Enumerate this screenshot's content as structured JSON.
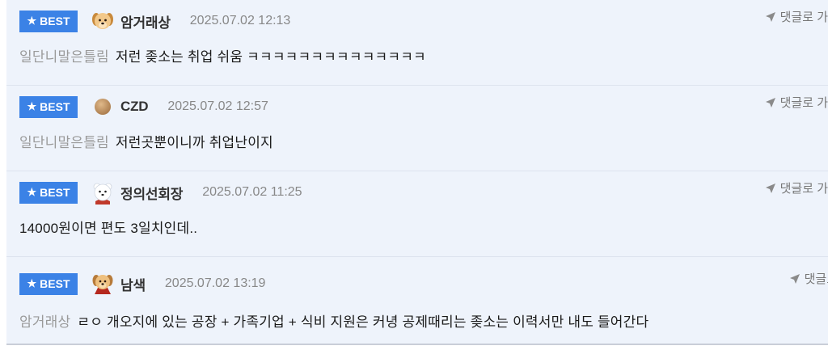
{
  "comments": [
    {
      "badge": "BEST",
      "avatar": "puppy-avatar",
      "nickname": "암거래상",
      "date": "2025.07.02 12:13",
      "reply_label": "댓글로 가",
      "mention": "일단니말은틀림",
      "text": "저런 좆소는 취업 쉬움 ㅋㅋㅋㅋㅋㅋㅋㅋㅋㅋㅋㅋㅋㅋ"
    },
    {
      "badge": "BEST",
      "avatar": "brown-circle-avatar",
      "nickname": "CZD",
      "date": "2025.07.02 12:57",
      "reply_label": "댓글로 가",
      "mention": "일단니말은틀림",
      "text": "저런곳뿐이니까 취업난이지"
    },
    {
      "badge": "BEST",
      "avatar": "white-bear-avatar",
      "nickname": "정의선회장",
      "date": "2025.07.02 11:25",
      "reply_label": "댓글로 가",
      "mention": "",
      "text": "14000원이면 편도 3일치인데.."
    },
    {
      "badge": "BEST",
      "avatar": "caped-puppy-avatar",
      "nickname": "남색",
      "date": "2025.07.02 13:19",
      "reply_label": "댓글로 ",
      "mention": "암거래상",
      "text": "ㄹㅇ 개오지에 있는 공장 + 가족기업 + 식비 지원은 커녕 공제때리는 좆소는 이력서만 내도 들어간다"
    }
  ],
  "colors": {
    "badge_bg": "#3b82e6",
    "list_bg": "#eef3fb",
    "mention": "#9a9a9a",
    "date": "#888888"
  }
}
